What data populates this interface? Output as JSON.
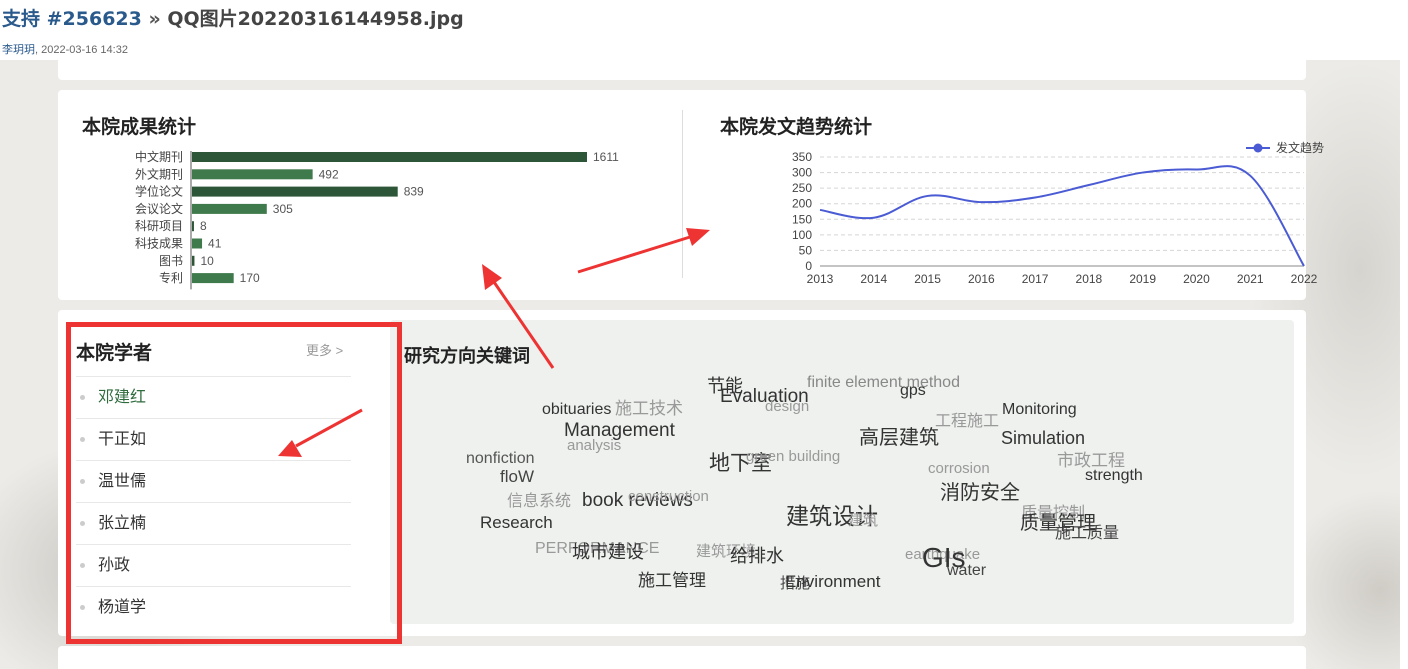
{
  "issue": {
    "link": "支持 #256623",
    "separator": " » ",
    "filename": "QQ图片20220316144958.jpg",
    "author": "李玥玥",
    "timestamp": ", 2022-03-16 14:32"
  },
  "stats": {
    "title": "本院成果统计",
    "items": [
      {
        "label": "中文期刊",
        "value": 1611
      },
      {
        "label": "外文期刊",
        "value": 492
      },
      {
        "label": "学位论文",
        "value": 839
      },
      {
        "label": "会议论文",
        "value": 305
      },
      {
        "label": "科研项目",
        "value": 8
      },
      {
        "label": "科技成果",
        "value": 41
      },
      {
        "label": "图书",
        "value": 10
      },
      {
        "label": "专利",
        "value": 170
      }
    ],
    "colors": [
      "#2c5637",
      "#3f7a4c"
    ]
  },
  "trend": {
    "title": "本院发文趋势统计",
    "legend": "发文趋势",
    "color": "#4a5bd4"
  },
  "chart_data": [
    {
      "type": "bar",
      "title": "本院成果统计",
      "categories": [
        "中文期刊",
        "外文期刊",
        "学位论文",
        "会议论文",
        "科研项目",
        "科技成果",
        "图书",
        "专利"
      ],
      "values": [
        1611,
        492,
        839,
        305,
        8,
        41,
        10,
        170
      ],
      "orientation": "horizontal"
    },
    {
      "type": "line",
      "title": "本院发文趋势统计",
      "x": [
        2013,
        2014,
        2015,
        2016,
        2017,
        2018,
        2019,
        2020,
        2021,
        2022
      ],
      "series": [
        {
          "name": "发文趋势",
          "values": [
            180,
            155,
            225,
            205,
            220,
            260,
            300,
            310,
            290,
            0
          ]
        }
      ],
      "ylim": [
        0,
        350
      ],
      "yticks": [
        0,
        50,
        100,
        150,
        200,
        250,
        300,
        350
      ],
      "legend": "top-right",
      "grid": true
    }
  ],
  "scholars": {
    "title": "本院学者",
    "more": "更多 >",
    "items": [
      "邓建红",
      "干正如",
      "温世儒",
      "张立楠",
      "孙政",
      "杨道学"
    ]
  },
  "keywords": {
    "title": "研究方向关键词",
    "words": [
      {
        "text": "节能",
        "color": "#333"
      },
      {
        "text": "finite element method",
        "color": "#888"
      },
      {
        "text": "gps",
        "color": "#333"
      },
      {
        "text": "施工技术",
        "color": "#999"
      },
      {
        "text": "Evaluation",
        "color": "#333"
      },
      {
        "text": "design",
        "color": "#999"
      },
      {
        "text": "obituaries",
        "color": "#333"
      },
      {
        "text": "工程施工",
        "color": "#999"
      },
      {
        "text": "Monitoring",
        "color": "#333"
      },
      {
        "text": "Management",
        "color": "#333"
      },
      {
        "text": "高层建筑",
        "color": "#333"
      },
      {
        "text": "analysis",
        "color": "#999"
      },
      {
        "text": "Simulation",
        "color": "#333"
      },
      {
        "text": "地下室",
        "color": "#333"
      },
      {
        "text": "green building",
        "color": "#999"
      },
      {
        "text": "nonfiction",
        "color": "#555"
      },
      {
        "text": "市政工程",
        "color": "#999"
      },
      {
        "text": "corrosion",
        "color": "#999"
      },
      {
        "text": "floW",
        "color": "#444"
      },
      {
        "text": "strength",
        "color": "#333"
      },
      {
        "text": "消防安全",
        "color": "#333"
      },
      {
        "text": "信息系统",
        "color": "#999"
      },
      {
        "text": "book reviews",
        "color": "#333"
      },
      {
        "text": "construction",
        "color": "#999"
      },
      {
        "text": "质量控制",
        "color": "#999"
      },
      {
        "text": "建筑设计",
        "color": "#333"
      },
      {
        "text": "质量管理",
        "color": "#333"
      },
      {
        "text": "Research",
        "color": "#333"
      },
      {
        "text": "建筑",
        "color": "#999"
      },
      {
        "text": "施工质量",
        "color": "#444"
      },
      {
        "text": "PERFORMANCE",
        "color": "#999"
      },
      {
        "text": "城市建设",
        "color": "#333"
      },
      {
        "text": "建筑环境",
        "color": "#999"
      },
      {
        "text": "给排水",
        "color": "#333"
      },
      {
        "text": "earthquake",
        "color": "#999"
      },
      {
        "text": "GIs",
        "color": "#333"
      },
      {
        "text": "water",
        "color": "#444"
      },
      {
        "text": "施工管理",
        "color": "#333"
      },
      {
        "text": "措施",
        "color": "#444"
      },
      {
        "text": "Environment",
        "color": "#333"
      }
    ]
  }
}
